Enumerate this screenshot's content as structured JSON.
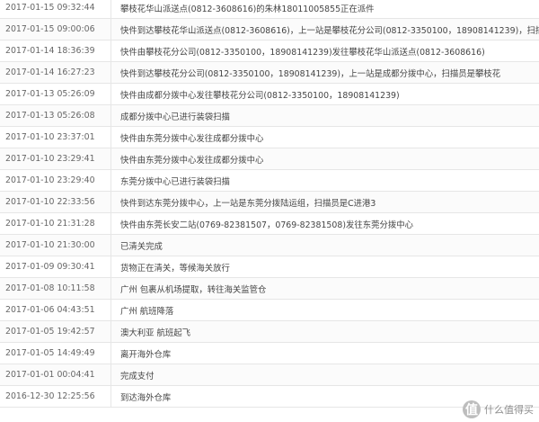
{
  "tracking": {
    "rows": [
      {
        "time": "2017-01-15 09:32:44",
        "desc": "攀枝花华山派送点(0812-3608616)的朱林18011005855正在派件"
      },
      {
        "time": "2017-01-15 09:00:06",
        "desc": "快件到达攀枝花华山派送点(0812-3608616)，上一站是攀枝花分公司(0812-3350100，18908141239)，扫描员是朱林18011005855"
      },
      {
        "time": "2017-01-14 18:36:39",
        "desc": "快件由攀枝花分公司(0812-3350100，18908141239)发往攀枝花华山派送点(0812-3608616)"
      },
      {
        "time": "2017-01-14 16:27:23",
        "desc": "快件到达攀枝花分公司(0812-3350100，18908141239)，上一站是成都分拨中心，扫描员是攀枝花"
      },
      {
        "time": "2017-01-13 05:26:09",
        "desc": "快件由成都分拨中心发往攀枝花分公司(0812-3350100，18908141239)"
      },
      {
        "time": "2017-01-13 05:26:08",
        "desc": "成都分拨中心已进行装袋扫描"
      },
      {
        "time": "2017-01-10 23:37:01",
        "desc": "快件由东莞分拨中心发往成都分拨中心"
      },
      {
        "time": "2017-01-10 23:29:41",
        "desc": "快件由东莞分拨中心发往成都分拨中心"
      },
      {
        "time": "2017-01-10 23:29:40",
        "desc": "东莞分拨中心已进行装袋扫描"
      },
      {
        "time": "2017-01-10 22:33:56",
        "desc": "快件到达东莞分拨中心，上一站是东莞分拨陆运组，扫描员是C进港3"
      },
      {
        "time": "2017-01-10 21:31:28",
        "desc": "快件由东莞长安二站(0769-82381507，0769-82381508)发往东莞分拨中心"
      },
      {
        "time": "2017-01-10 21:30:00",
        "desc": "已清关完成"
      },
      {
        "time": "2017-01-09 09:30:41",
        "desc": "货物正在清关，等候海关放行"
      },
      {
        "time": "2017-01-08 10:11:58",
        "desc": "广州 包裹从机场提取，转往海关监管仓"
      },
      {
        "time": "2017-01-06 04:43:51",
        "desc": "广州 航班降落"
      },
      {
        "time": "2017-01-05 19:42:57",
        "desc": "澳大利亚 航班起飞"
      },
      {
        "time": "2017-01-05 14:49:49",
        "desc": "离开海外仓库"
      },
      {
        "time": "2017-01-01 00:04:41",
        "desc": "完成支付"
      },
      {
        "time": "2016-12-30 12:25:56",
        "desc": "到达海外仓库"
      }
    ]
  },
  "watermark": {
    "logo_glyph": "值",
    "text": "什么值得买",
    "color": "#8f8f8f"
  }
}
